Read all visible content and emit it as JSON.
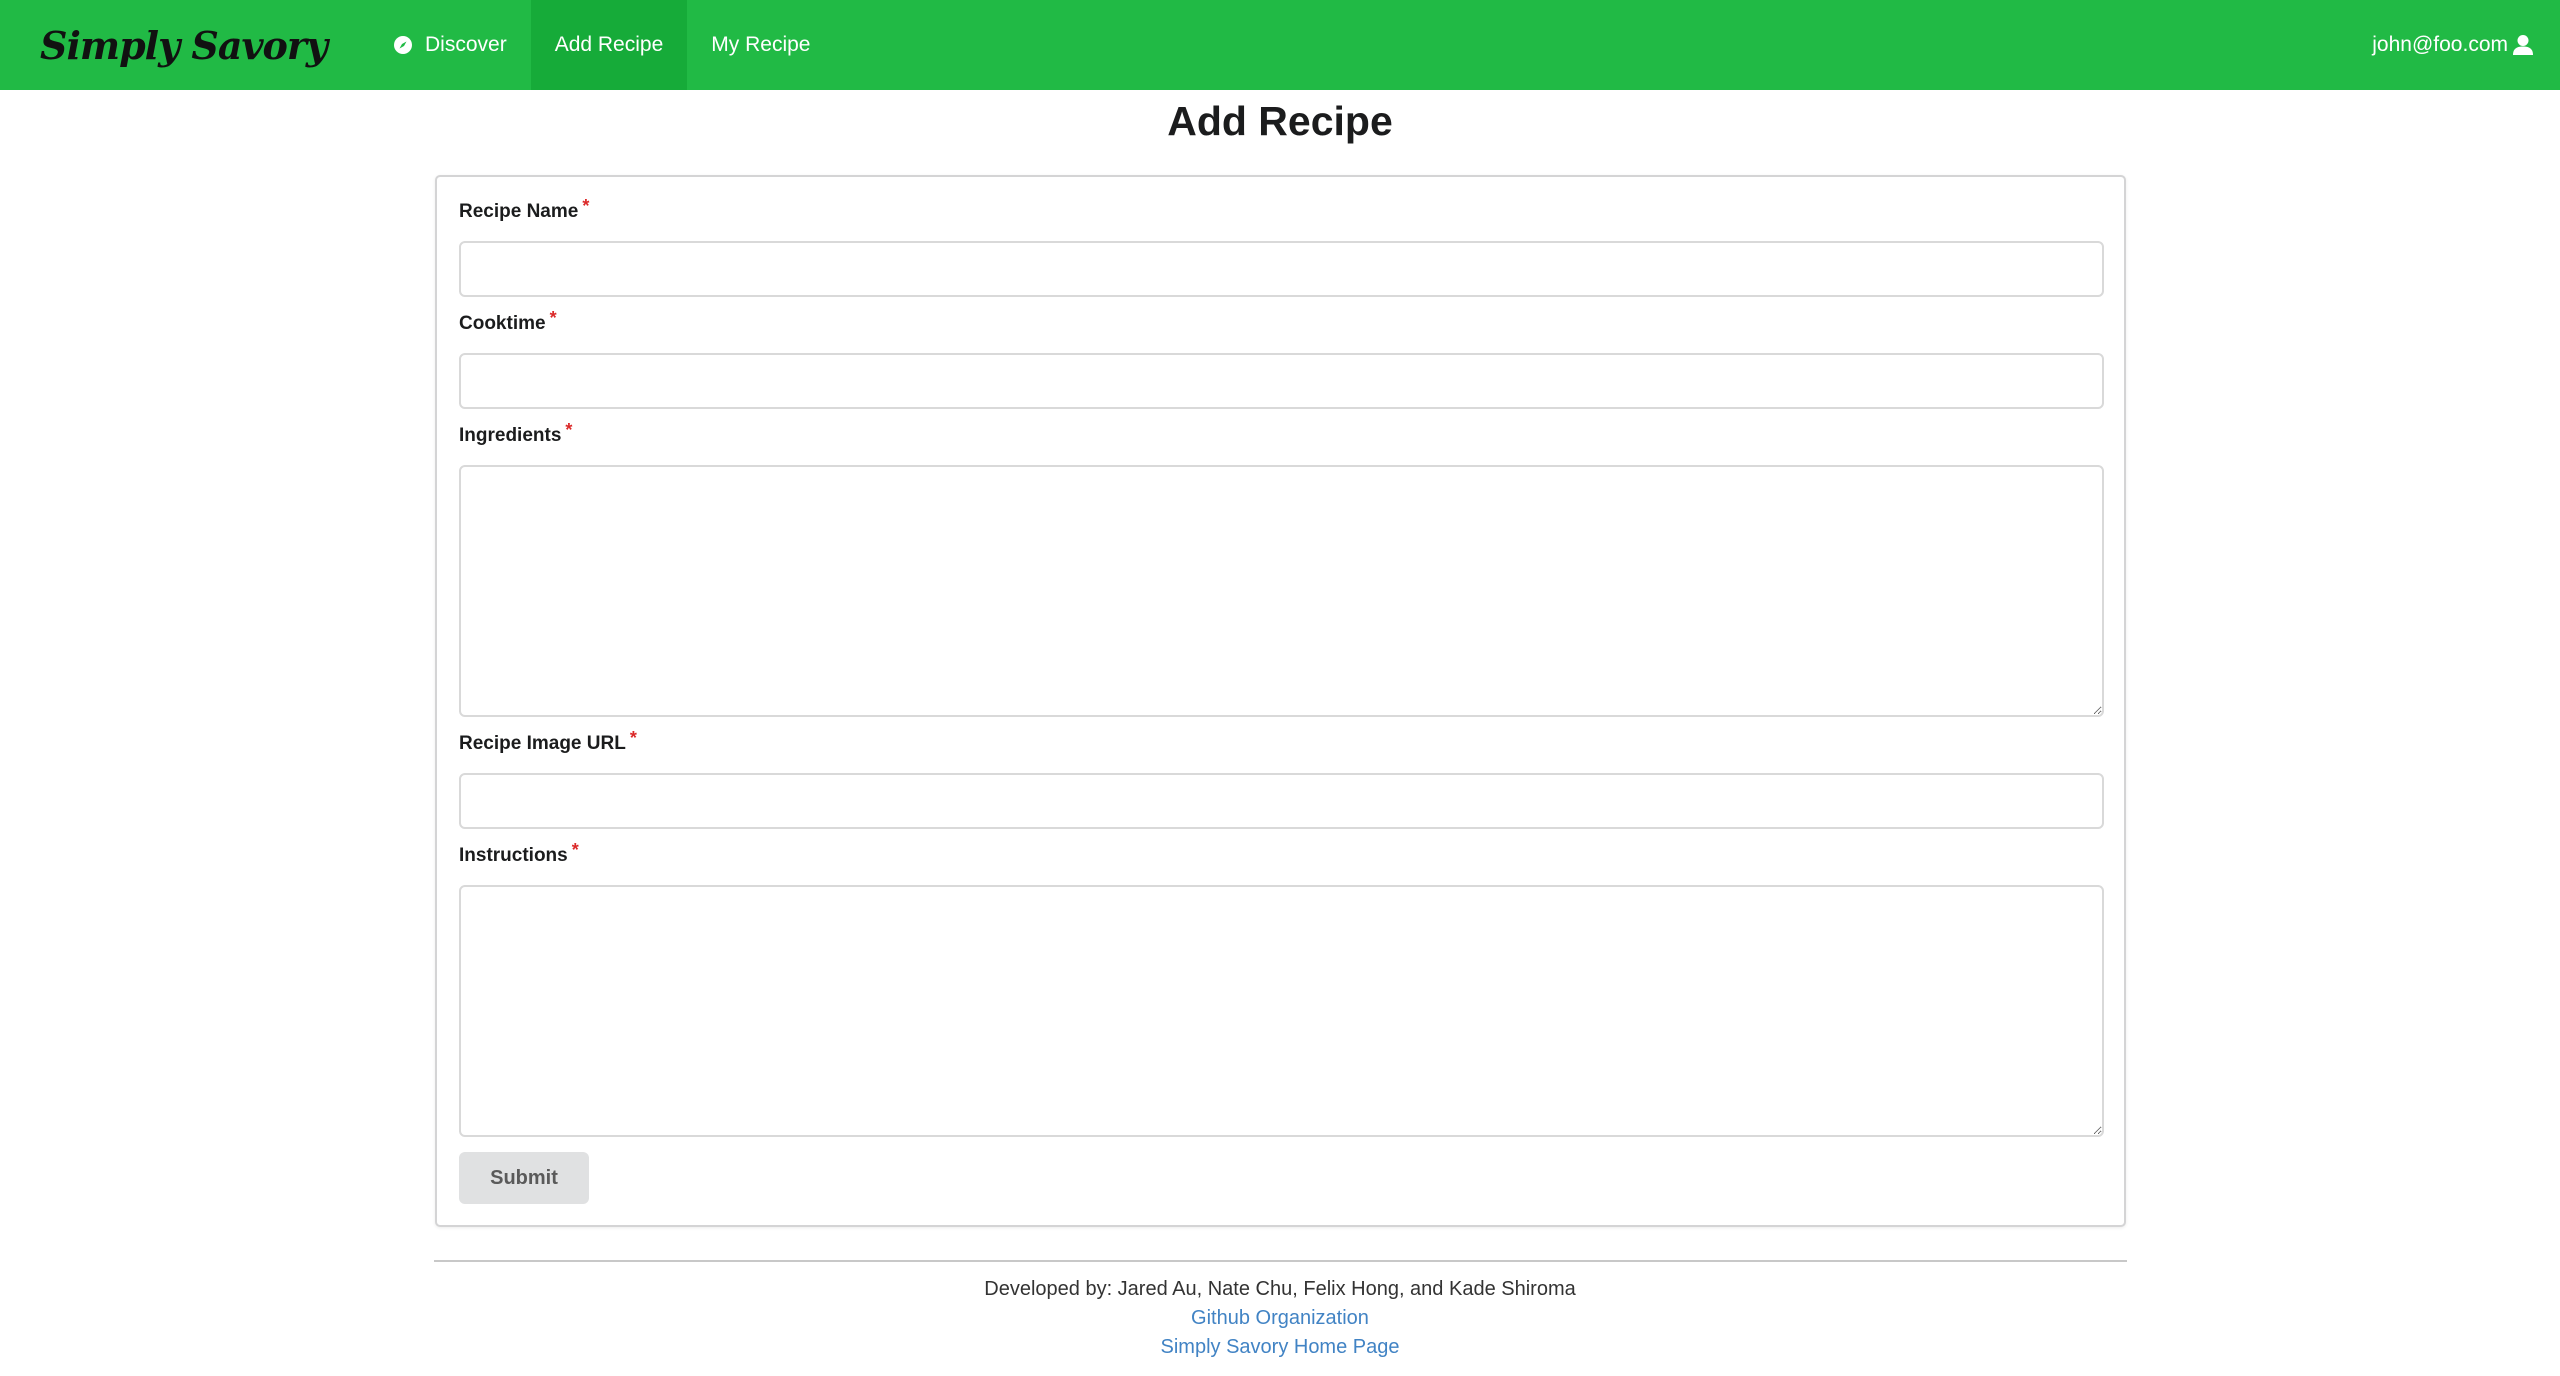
{
  "navbar": {
    "brand": "Simply Savory",
    "items": [
      {
        "label": "Discover",
        "icon": "compass-icon",
        "active": false
      },
      {
        "label": "Add Recipe",
        "active": true
      },
      {
        "label": "My Recipe",
        "active": false
      }
    ],
    "user_email": "john@foo.com",
    "user_icon": "user-icon"
  },
  "page": {
    "title": "Add Recipe"
  },
  "form": {
    "required_marker": "*",
    "fields": [
      {
        "label": "Recipe Name",
        "value": "",
        "type": "input"
      },
      {
        "label": "Cooktime",
        "value": "",
        "type": "input"
      },
      {
        "label": "Ingredients",
        "value": "",
        "type": "textarea"
      },
      {
        "label": "Recipe Image URL",
        "value": "",
        "type": "input"
      },
      {
        "label": "Instructions",
        "value": "",
        "type": "textarea"
      }
    ],
    "submit_label": "Submit"
  },
  "footer": {
    "credits": "Developed by: Jared Au, Nate Chu, Felix Hong, and Kade Shiroma",
    "links": [
      "Github Organization",
      "Simply Savory Home Page"
    ]
  },
  "colors": {
    "navbar_bg": "#21ba45",
    "navbar_active": "#16ab39",
    "link": "#4183c4",
    "required": "#db2828"
  }
}
